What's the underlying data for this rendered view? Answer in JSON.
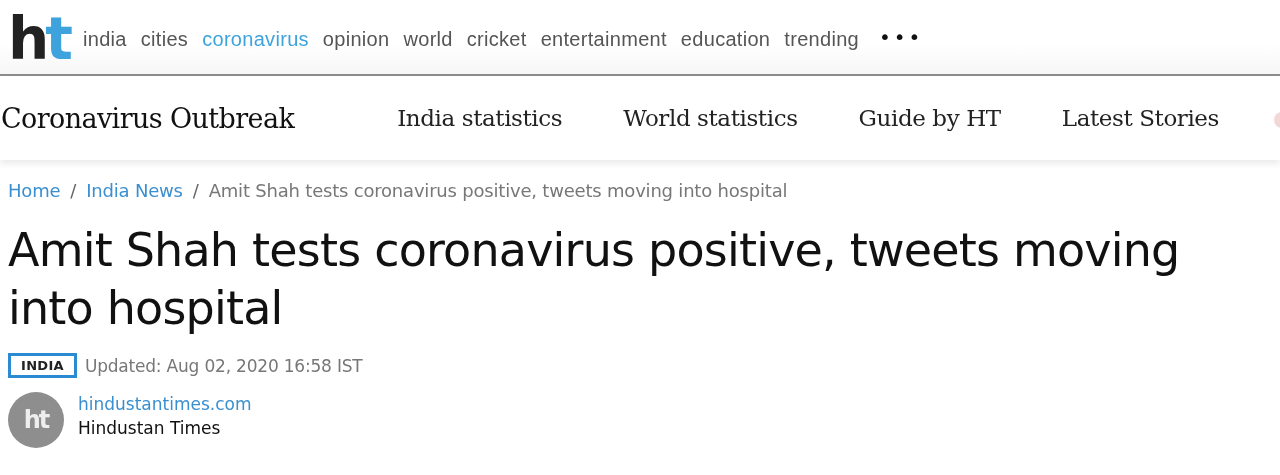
{
  "logo": {
    "letters": [
      "h",
      "t"
    ]
  },
  "top_nav": {
    "items": [
      {
        "label": "india",
        "selected": false
      },
      {
        "label": "cities",
        "selected": false
      },
      {
        "label": "coronavirus",
        "selected": true
      },
      {
        "label": "opinion",
        "selected": false
      },
      {
        "label": "world",
        "selected": false
      },
      {
        "label": "cricket",
        "selected": false
      },
      {
        "label": "entertainment",
        "selected": false
      },
      {
        "label": "education",
        "selected": false
      },
      {
        "label": "trending",
        "selected": false
      }
    ],
    "more": "•••"
  },
  "section_bar": {
    "title": "Coronavirus Outbreak",
    "links": [
      "India statistics",
      "World statistics",
      "Guide by HT",
      "Latest Stories"
    ]
  },
  "breadcrumb": [
    {
      "label": "Home",
      "kind": "link"
    },
    {
      "label": "India News",
      "kind": "link"
    },
    {
      "label": "Amit Shah tests coronavirus positive, tweets moving into hospital",
      "kind": "current"
    }
  ],
  "breadcrumb_separator": "/",
  "article": {
    "headline": "Amit Shah tests coronavirus positive, tweets moving into hospital",
    "tag": "INDIA",
    "updated": "Updated: Aug 02, 2020 16:58 IST",
    "author": {
      "avatar_text": "ht",
      "site": "hindustantimes.com",
      "name": "Hindustan Times"
    }
  }
}
